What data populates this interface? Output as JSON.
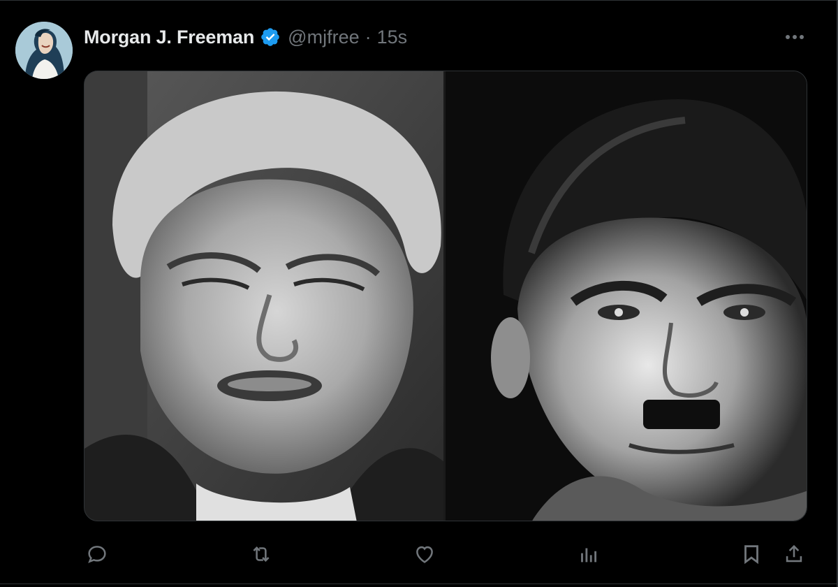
{
  "tweet": {
    "display_name": "Morgan J. Freeman",
    "handle": "@mjfree",
    "separator": "·",
    "timestamp": "15s",
    "verified": true
  },
  "icons": {
    "verified": "verified-badge-icon",
    "more": "more-horizontal-icon",
    "reply": "reply-icon",
    "repost": "repost-icon",
    "like": "like-icon",
    "views": "views-icon",
    "bookmark": "bookmark-icon",
    "share": "share-icon"
  },
  "colors": {
    "background": "#000000",
    "primary_text": "#e7e9ea",
    "secondary_text": "#71767b",
    "verified": "#1d9bf0",
    "border": "#2f3336"
  }
}
